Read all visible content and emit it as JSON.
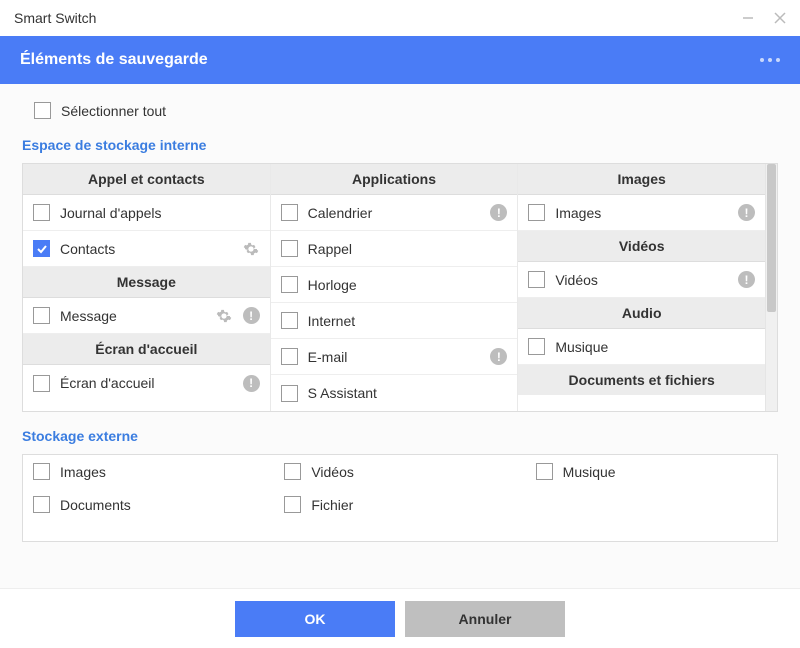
{
  "window": {
    "title": "Smart Switch"
  },
  "header": {
    "title": "Éléments de sauvegarde"
  },
  "select_all": {
    "label": "Sélectionner tout"
  },
  "internal": {
    "title": "Espace de stockage interne",
    "col1": {
      "g1": {
        "header": "Appel et contacts"
      },
      "i1": {
        "label": "Journal d'appels"
      },
      "i2": {
        "label": "Contacts"
      },
      "g2": {
        "header": "Message"
      },
      "i3": {
        "label": "Message"
      },
      "g3": {
        "header": "Écran d'accueil"
      },
      "i4": {
        "label": "Écran d'accueil"
      }
    },
    "col2": {
      "g1": {
        "header": "Applications"
      },
      "i1": {
        "label": "Calendrier"
      },
      "i2": {
        "label": "Rappel"
      },
      "i3": {
        "label": "Horloge"
      },
      "i4": {
        "label": "Internet"
      },
      "i5": {
        "label": "E-mail"
      },
      "i6": {
        "label": "S Assistant"
      }
    },
    "col3": {
      "g1": {
        "header": "Images"
      },
      "i1": {
        "label": "Images"
      },
      "g2": {
        "header": "Vidéos"
      },
      "i2": {
        "label": "Vidéos"
      },
      "g3": {
        "header": "Audio"
      },
      "i3": {
        "label": "Musique"
      },
      "g4": {
        "header": "Documents et fichiers"
      }
    }
  },
  "external": {
    "title": "Stockage externe",
    "col1": {
      "i1": {
        "label": "Images"
      },
      "i2": {
        "label": "Documents"
      }
    },
    "col2": {
      "i1": {
        "label": "Vidéos"
      },
      "i2": {
        "label": "Fichier"
      }
    },
    "col3": {
      "i1": {
        "label": "Musique"
      }
    }
  },
  "footer": {
    "ok": "OK",
    "cancel": "Annuler"
  }
}
